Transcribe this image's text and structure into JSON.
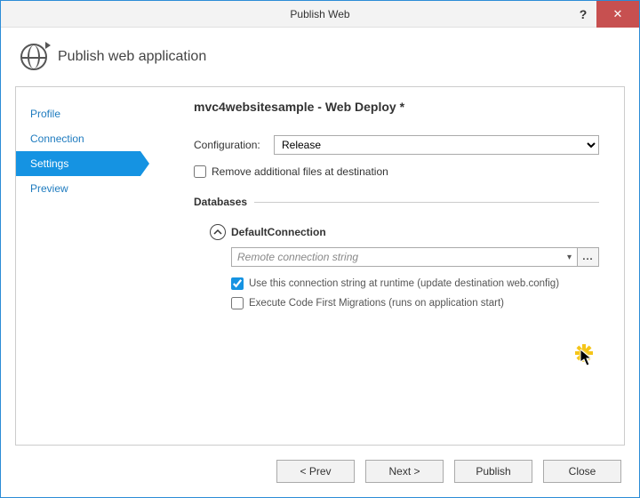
{
  "window": {
    "title": "Publish Web",
    "header": "Publish web application"
  },
  "sidebar": {
    "items": [
      {
        "label": "Profile",
        "selected": false
      },
      {
        "label": "Connection",
        "selected": false
      },
      {
        "label": "Settings",
        "selected": true
      },
      {
        "label": "Preview",
        "selected": false
      }
    ]
  },
  "main": {
    "heading": "mvc4websitesample - Web Deploy *",
    "config_label": "Configuration:",
    "config_value": "Release",
    "remove_files_label": "Remove additional files at destination",
    "remove_files_checked": false,
    "db_section": "Databases",
    "db_name": "DefaultConnection",
    "conn_placeholder": "Remote connection string",
    "conn_button": "...",
    "use_conn_label": "Use this connection string at runtime (update destination web.config)",
    "use_conn_checked": true,
    "exec_migrations_label": "Execute Code First Migrations (runs on application start)",
    "exec_migrations_checked": false
  },
  "buttons": {
    "prev": "< Prev",
    "next": "Next >",
    "publish": "Publish",
    "close": "Close"
  }
}
